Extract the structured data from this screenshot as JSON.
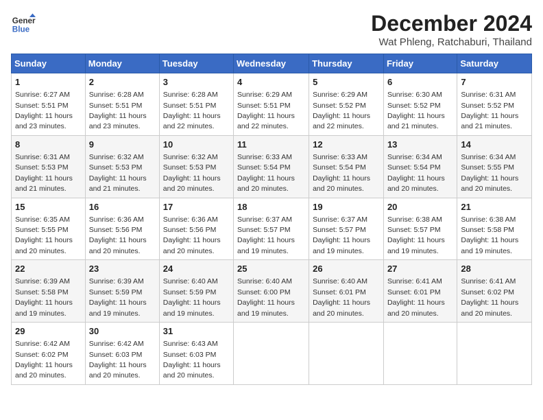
{
  "header": {
    "logo_line1": "General",
    "logo_line2": "Blue",
    "title": "December 2024",
    "subtitle": "Wat Phleng, Ratchaburi, Thailand"
  },
  "calendar": {
    "columns": [
      "Sunday",
      "Monday",
      "Tuesday",
      "Wednesday",
      "Thursday",
      "Friday",
      "Saturday"
    ],
    "weeks": [
      [
        null,
        null,
        null,
        null,
        null,
        null,
        null
      ]
    ],
    "days": {
      "1": {
        "sunrise": "6:27 AM",
        "sunset": "5:51 PM",
        "daylight": "11 hours and 23 minutes."
      },
      "2": {
        "sunrise": "6:28 AM",
        "sunset": "5:51 PM",
        "daylight": "11 hours and 23 minutes."
      },
      "3": {
        "sunrise": "6:28 AM",
        "sunset": "5:51 PM",
        "daylight": "11 hours and 22 minutes."
      },
      "4": {
        "sunrise": "6:29 AM",
        "sunset": "5:51 PM",
        "daylight": "11 hours and 22 minutes."
      },
      "5": {
        "sunrise": "6:29 AM",
        "sunset": "5:52 PM",
        "daylight": "11 hours and 22 minutes."
      },
      "6": {
        "sunrise": "6:30 AM",
        "sunset": "5:52 PM",
        "daylight": "11 hours and 21 minutes."
      },
      "7": {
        "sunrise": "6:31 AM",
        "sunset": "5:52 PM",
        "daylight": "11 hours and 21 minutes."
      },
      "8": {
        "sunrise": "6:31 AM",
        "sunset": "5:53 PM",
        "daylight": "11 hours and 21 minutes."
      },
      "9": {
        "sunrise": "6:32 AM",
        "sunset": "5:53 PM",
        "daylight": "11 hours and 21 minutes."
      },
      "10": {
        "sunrise": "6:32 AM",
        "sunset": "5:53 PM",
        "daylight": "11 hours and 20 minutes."
      },
      "11": {
        "sunrise": "6:33 AM",
        "sunset": "5:54 PM",
        "daylight": "11 hours and 20 minutes."
      },
      "12": {
        "sunrise": "6:33 AM",
        "sunset": "5:54 PM",
        "daylight": "11 hours and 20 minutes."
      },
      "13": {
        "sunrise": "6:34 AM",
        "sunset": "5:54 PM",
        "daylight": "11 hours and 20 minutes."
      },
      "14": {
        "sunrise": "6:34 AM",
        "sunset": "5:55 PM",
        "daylight": "11 hours and 20 minutes."
      },
      "15": {
        "sunrise": "6:35 AM",
        "sunset": "5:55 PM",
        "daylight": "11 hours and 20 minutes."
      },
      "16": {
        "sunrise": "6:36 AM",
        "sunset": "5:56 PM",
        "daylight": "11 hours and 20 minutes."
      },
      "17": {
        "sunrise": "6:36 AM",
        "sunset": "5:56 PM",
        "daylight": "11 hours and 20 minutes."
      },
      "18": {
        "sunrise": "6:37 AM",
        "sunset": "5:57 PM",
        "daylight": "11 hours and 19 minutes."
      },
      "19": {
        "sunrise": "6:37 AM",
        "sunset": "5:57 PM",
        "daylight": "11 hours and 19 minutes."
      },
      "20": {
        "sunrise": "6:38 AM",
        "sunset": "5:57 PM",
        "daylight": "11 hours and 19 minutes."
      },
      "21": {
        "sunrise": "6:38 AM",
        "sunset": "5:58 PM",
        "daylight": "11 hours and 19 minutes."
      },
      "22": {
        "sunrise": "6:39 AM",
        "sunset": "5:58 PM",
        "daylight": "11 hours and 19 minutes."
      },
      "23": {
        "sunrise": "6:39 AM",
        "sunset": "5:59 PM",
        "daylight": "11 hours and 19 minutes."
      },
      "24": {
        "sunrise": "6:40 AM",
        "sunset": "5:59 PM",
        "daylight": "11 hours and 19 minutes."
      },
      "25": {
        "sunrise": "6:40 AM",
        "sunset": "6:00 PM",
        "daylight": "11 hours and 19 minutes."
      },
      "26": {
        "sunrise": "6:40 AM",
        "sunset": "6:01 PM",
        "daylight": "11 hours and 20 minutes."
      },
      "27": {
        "sunrise": "6:41 AM",
        "sunset": "6:01 PM",
        "daylight": "11 hours and 20 minutes."
      },
      "28": {
        "sunrise": "6:41 AM",
        "sunset": "6:02 PM",
        "daylight": "11 hours and 20 minutes."
      },
      "29": {
        "sunrise": "6:42 AM",
        "sunset": "6:02 PM",
        "daylight": "11 hours and 20 minutes."
      },
      "30": {
        "sunrise": "6:42 AM",
        "sunset": "6:03 PM",
        "daylight": "11 hours and 20 minutes."
      },
      "31": {
        "sunrise": "6:43 AM",
        "sunset": "6:03 PM",
        "daylight": "11 hours and 20 minutes."
      }
    }
  }
}
